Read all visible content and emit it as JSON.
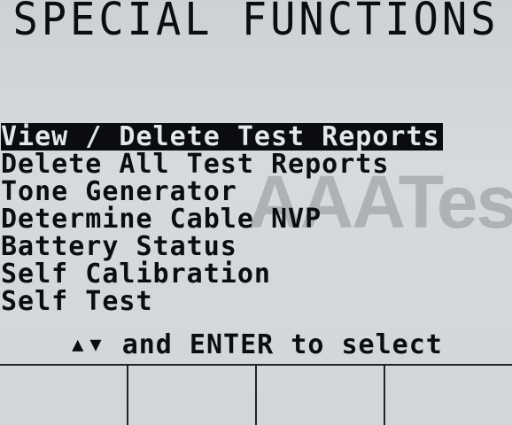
{
  "header": {
    "title": "SPECIAL FUNCTIONS"
  },
  "menu": {
    "selected_index": 0,
    "items": [
      {
        "label": "View / Delete Test Reports"
      },
      {
        "label": "Delete All Test Reports"
      },
      {
        "label": "Tone Generator"
      },
      {
        "label": "Determine Cable NVP"
      },
      {
        "label": "Battery Status"
      },
      {
        "label": "Self Calibration"
      },
      {
        "label": "Self Test"
      }
    ]
  },
  "hint": {
    "up_arrow": "▲",
    "down_arrow": "▼",
    "text": "and ENTER to select"
  },
  "watermark": {
    "text": "AAATesters"
  },
  "softkeys": [
    {
      "label": ""
    },
    {
      "label": ""
    },
    {
      "label": ""
    },
    {
      "label": ""
    }
  ],
  "colors": {
    "screen_background": "#d2d6d9",
    "text": "#0b0d12",
    "selection_background": "#0a0c10",
    "selection_text": "#e4e7ea"
  }
}
